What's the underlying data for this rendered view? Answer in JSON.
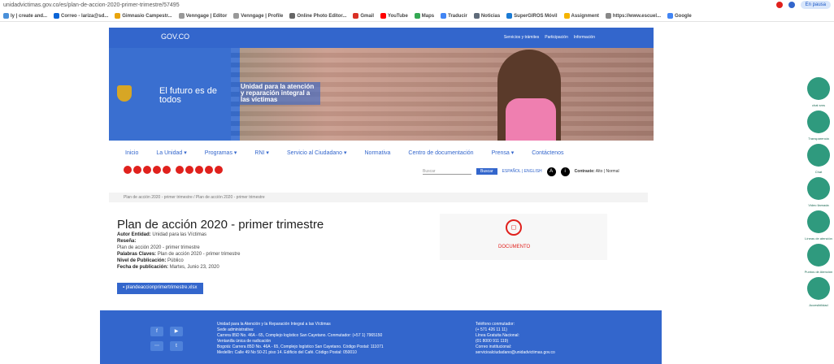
{
  "browser": {
    "url": "unidadvictimas.gov.co/es/plan-de-accion-2020-primer-trimestre/57495",
    "pause_label": "En pausa",
    "bookmarks": [
      "ly | create and...",
      "Correo - lariza@sd...",
      "Gimnasio Campestr...",
      "Venngage | Editor",
      "Venngage | Profile",
      "Online Photo Editor...",
      "Gmail",
      "YouTube",
      "Maps",
      "Traducir",
      "Noticias",
      "SuperGIROS Móvil",
      "Assignment",
      "https://www.escuel...",
      "Google"
    ]
  },
  "gov": {
    "logo": "GOV.CO",
    "links": [
      "Servicios y trámites",
      "Participación",
      "Información"
    ]
  },
  "hero": {
    "futuro": "El futuro es de todos",
    "unidad": "Unidad para la atención y reparación integral a las víctimas"
  },
  "nav": [
    "Inicio",
    "La Unidad ▾",
    "Programas ▾",
    "RNI ▾",
    "Servicio al Ciudadano ▾",
    "Normativa",
    "Centro de documentación",
    "Prensa ▾",
    "Contáctenos"
  ],
  "tools": {
    "search_placeholder": "Buscar",
    "search_button": "Buscar",
    "langs": "ESPAÑOL | ENGLISH",
    "contrast_label": "Contraste:",
    "contrast_opts": "Alto | Normal"
  },
  "breadcrumb": "Plan de acción 2020 - primer trimestre  /  Plan de acción 2020 - primer trimestre",
  "doc": {
    "title": "Plan de acción 2020 - primer trimestre",
    "autor_k": "Autor Entidad:",
    "autor_v": "Unidad para las Víctimas",
    "resena_k": "Reseña:",
    "resena_v": "Plan de acción 2020 - primer trimestre",
    "claves_k": "Palabras Claves:",
    "claves_v": "Plan de acción 2020 - primer trimestre",
    "nivel_k": "Nivel de Publicación:",
    "nivel_v": "Público",
    "fecha_k": "Fecha de publicación:",
    "fecha_v": "Martes, Junio 23, 2020",
    "file": "plandeaccionprimertrimestre.xlsx",
    "badge": "DOCUMENTO"
  },
  "footer": {
    "c1": [
      "Unidad para la Atención y la Reparación Integral a las Víctimas",
      "Sede administrativa:",
      "Carrera 85D No. 46A - 65, Complejo logístico San Cayetano. Conmutador: (+57 1) 7965150",
      "Ventanilla única de radicación",
      "Bogotá: Carrera 85D No. 46A - 65, Complejo logístico San Cayetano. Código Postal: 111071",
      "Medellín: Calle 49 No 50-21 piso 14. Edificio del Café. Código Postal: 050010"
    ],
    "c2": [
      "Teléfono conmutador:",
      "(+ 571 426 11 11)",
      "Línea Gratuita Nacional:",
      "(01 8000 911 119)",
      "Correo institucional:",
      "servicioalciudadano@unidadvictimas.gov.co"
    ]
  },
  "sidebar": [
    "chat sms",
    "Transparencia",
    "Chat",
    "Video llamada",
    "Líneas de atención",
    "Puntos de Atención",
    "Accesibilidad"
  ]
}
